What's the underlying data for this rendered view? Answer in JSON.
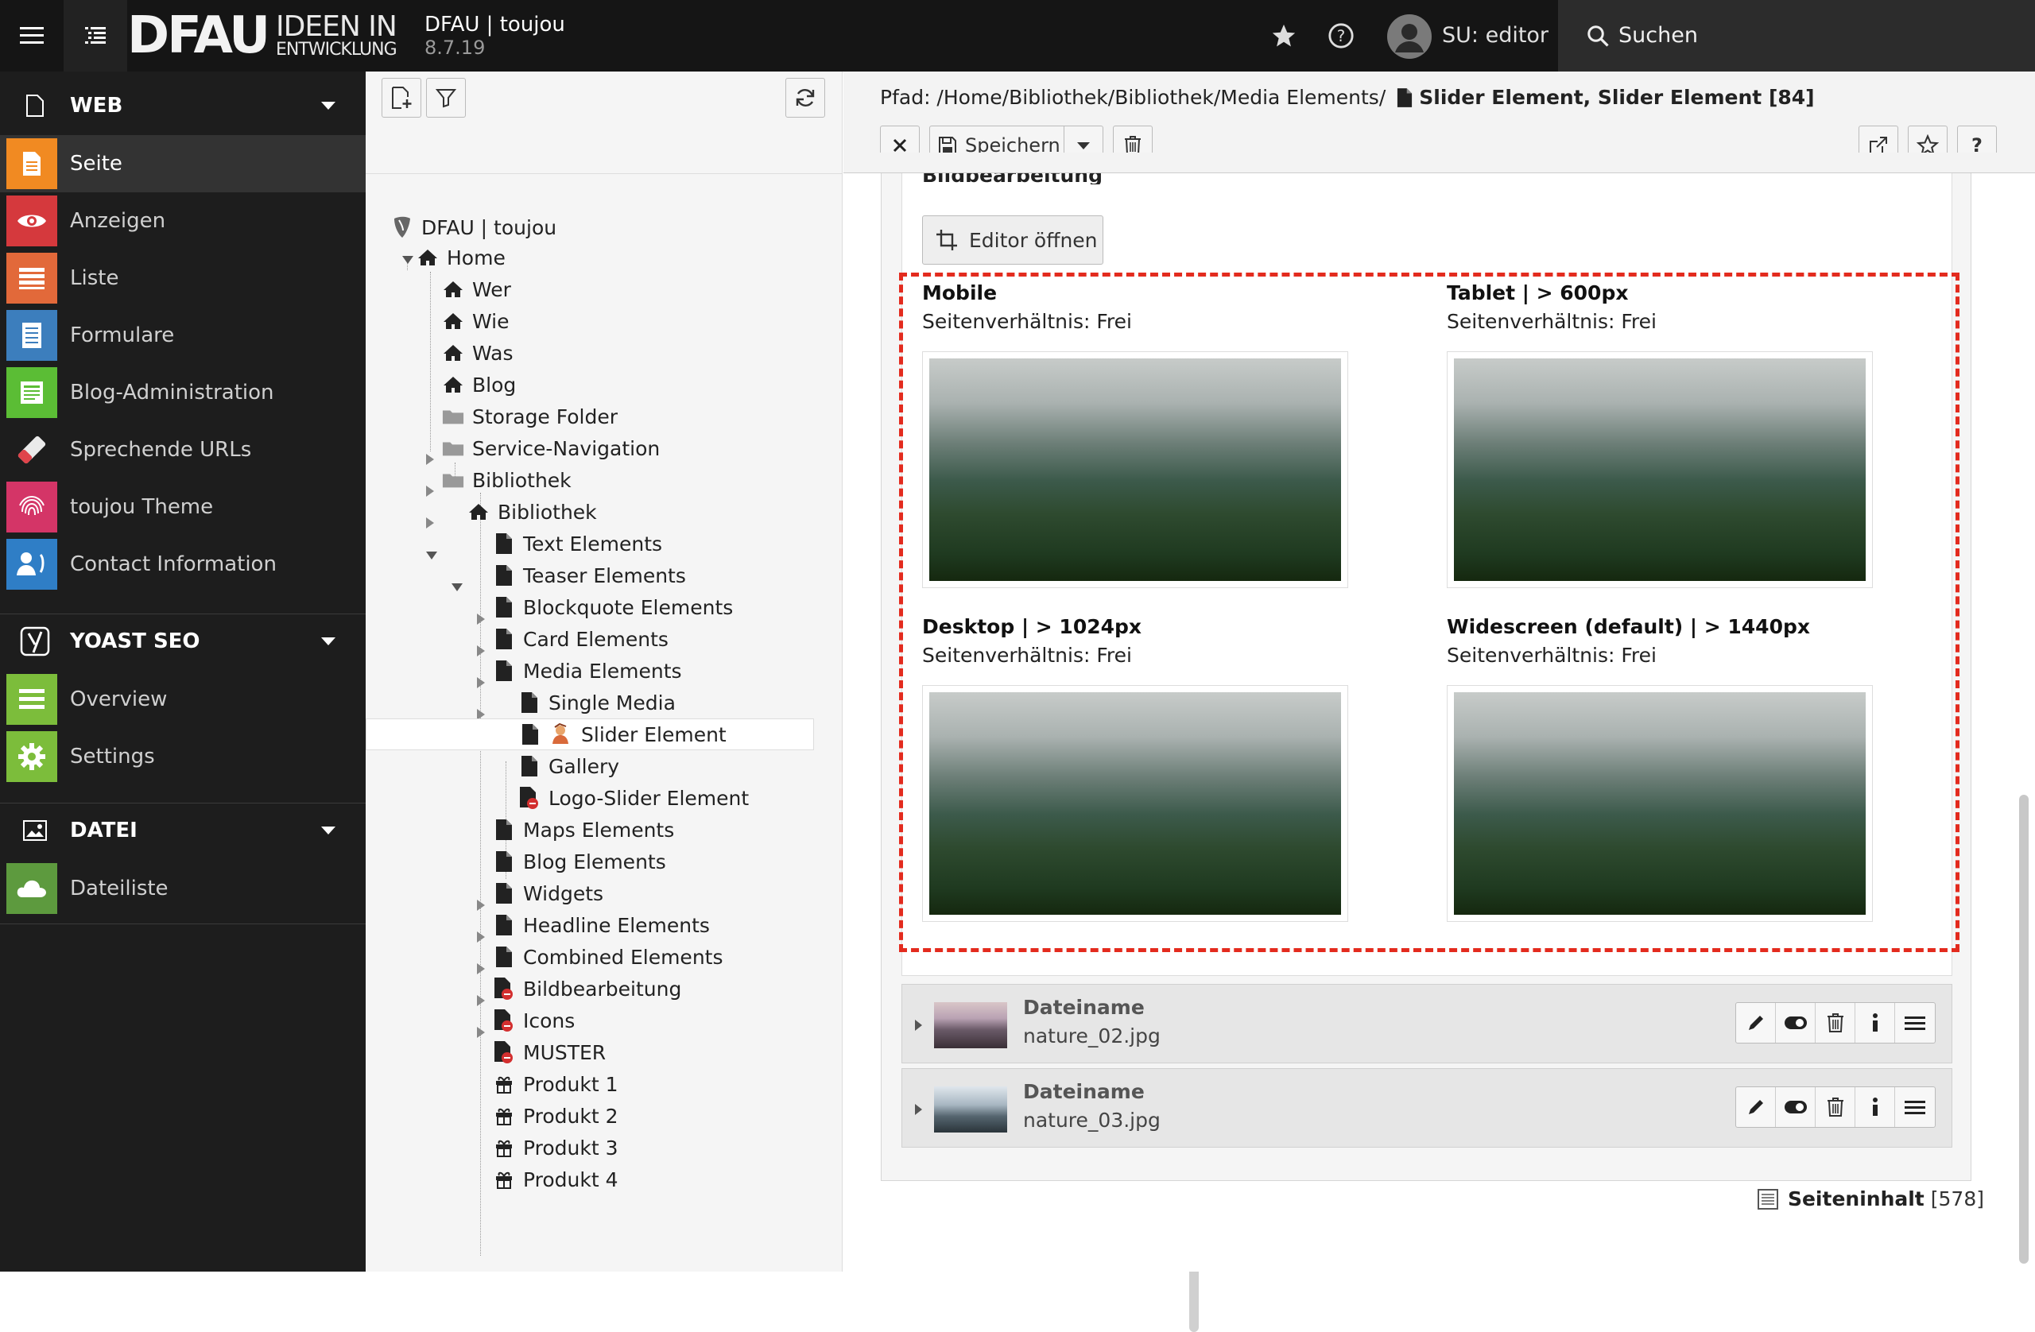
{
  "topbar": {
    "logo_main": "DFAU",
    "logo_line1": "IDEEN IN",
    "logo_line2": "ENTWICKLUNG",
    "site_name": "DFAU | toujou",
    "version": "8.7.19",
    "user_label": "SU: editor",
    "search_label": "Suchen"
  },
  "sidebar": {
    "groups": [
      {
        "label": "WEB",
        "items": [
          "Seite",
          "Anzeigen",
          "Liste",
          "Formulare",
          "Blog-Administration",
          "Sprechende URLs",
          "toujou Theme",
          "Contact Information"
        ]
      },
      {
        "label": "YOAST SEO",
        "items": [
          "Overview",
          "Settings"
        ]
      },
      {
        "label": "DATEI",
        "items": [
          "Dateiliste"
        ]
      }
    ],
    "colors": {
      "seite": "#f18a22",
      "anzeigen": "#d5393d",
      "liste": "#e2693a",
      "formulare": "#3c7ebd",
      "blog": "#5bbd35",
      "urls": "#d0d0d0",
      "theme": "#d43567",
      "contact": "#2f7ec6",
      "yoast_overview": "#7cbd3b",
      "yoast_settings": "#7cbd3b",
      "dateiliste": "#5d9a3e"
    }
  },
  "tree": {
    "root": "DFAU | toujou",
    "nodes": [
      "Home",
      "Wer",
      "Wie",
      "Was",
      "Blog",
      "Storage Folder",
      "Service-Navigation",
      "Bibliothek",
      "Bibliothek",
      "Text Elements",
      "Teaser Elements",
      "Blockquote Elements",
      "Card Elements",
      "Media Elements",
      "Single Media",
      "Slider Element",
      "Gallery",
      "Logo-Slider Element",
      "Maps Elements",
      "Blog Elements",
      "Widgets",
      "Headline Elements",
      "Combined Elements",
      "Bildbearbeitung",
      "Icons",
      "MUSTER",
      "Produkt 1",
      "Produkt 2",
      "Produkt 3",
      "Produkt 4"
    ]
  },
  "docheader": {
    "path_prefix": "Pfad: /Home/Bibliothek/Bibliothek/Media Elements/",
    "path_title": "Slider Element, Slider Element [84]",
    "save_label": "Speichern"
  },
  "form": {
    "section_title": "Bildbearbeitung",
    "editor_button": "Editor öffnen",
    "crops": [
      {
        "label": "Mobile",
        "ratio": "Seitenverhältnis: Frei"
      },
      {
        "label": "Tablet | > 600px",
        "ratio": "Seitenverhältnis: Frei"
      },
      {
        "label": "Desktop | > 1024px",
        "ratio": "Seitenverhältnis: Frei"
      },
      {
        "label": "Widescreen (default) | > 1440px",
        "ratio": "Seitenverhältnis: Frei"
      }
    ],
    "files": [
      {
        "field": "Dateiname",
        "value": "nature_02.jpg"
      },
      {
        "field": "Dateiname",
        "value": "nature_03.jpg"
      }
    ],
    "footer_label": "Seiteninhalt",
    "footer_id": "[578]"
  }
}
